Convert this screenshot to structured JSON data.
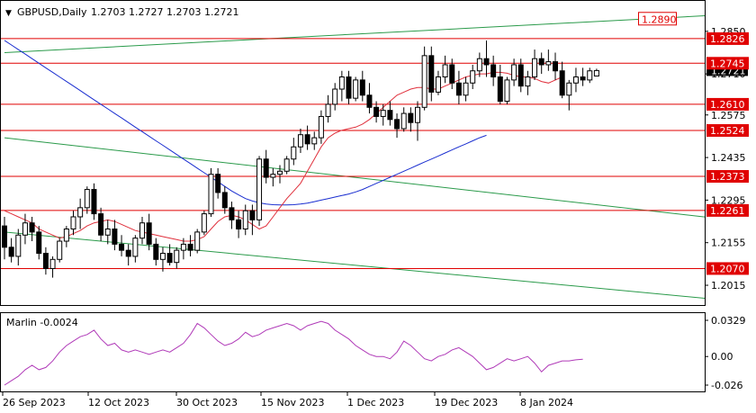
{
  "header": {
    "arrow": "▼",
    "symbol": "GBPUSD,Daily",
    "ohlc": "1.2703 1.2727 1.2703 1.2721"
  },
  "price_axis_ticks": [
    "1.2850",
    "1.2710",
    "1.2575",
    "1.2435",
    "1.2295",
    "1.2155",
    "1.2015"
  ],
  "current_price_label": "1.2721",
  "levels": [
    {
      "value": 1.289,
      "label": "1.2890",
      "boxed": true
    },
    {
      "value": 1.2826,
      "label": "1.2826",
      "boxed": false
    },
    {
      "value": 1.2745,
      "label": "1.2745",
      "boxed": false
    },
    {
      "value": 1.261,
      "label": "1.2610",
      "boxed": false
    },
    {
      "value": 1.2524,
      "label": "1.2524",
      "boxed": false
    },
    {
      "value": 1.2373,
      "label": "1.2373",
      "boxed": false
    },
    {
      "value": 1.2261,
      "label": "1.2261",
      "boxed": false
    },
    {
      "value": 1.207,
      "label": "1.2070",
      "boxed": false
    }
  ],
  "indicator": {
    "name": "Marlin -0.0024",
    "ticks": [
      "0.0329",
      "0.00",
      "-0.026"
    ]
  },
  "date_labels": [
    "26 Sep 2023",
    "12 Oct 2023",
    "30 Oct 2023",
    "15 Nov 2023",
    "1 Dec 2023",
    "19 Dec 2023",
    "8 Jan 2024"
  ],
  "colors": {
    "background": "#ffffff",
    "level_line": "#e00000",
    "red_ma": "#e0303c",
    "blue_ma": "#1a2ed0",
    "trend_line": "#2a9a4a",
    "marlin": "#b03ab8",
    "candle_bull": "#ffffff",
    "candle_bear": "#000000"
  },
  "chart_data": {
    "type": "candlestick",
    "symbol": "GBPUSD",
    "timeframe": "Daily",
    "ylim": [
      1.195,
      1.295
    ],
    "candles": [
      [
        1.221,
        1.224,
        1.21,
        1.214
      ],
      [
        1.214,
        1.217,
        1.209,
        1.211
      ],
      [
        1.211,
        1.22,
        1.208,
        1.218
      ],
      [
        1.218,
        1.225,
        1.215,
        1.222
      ],
      [
        1.222,
        1.224,
        1.216,
        1.219
      ],
      [
        1.219,
        1.221,
        1.21,
        1.212
      ],
      [
        1.212,
        1.214,
        1.205,
        1.207
      ],
      [
        1.207,
        1.211,
        1.204,
        1.21
      ],
      [
        1.21,
        1.217,
        1.209,
        1.216
      ],
      [
        1.216,
        1.221,
        1.214,
        1.22
      ],
      [
        1.22,
        1.226,
        1.218,
        1.224
      ],
      [
        1.224,
        1.23,
        1.22,
        1.227
      ],
      [
        1.227,
        1.234,
        1.225,
        1.233
      ],
      [
        1.233,
        1.235,
        1.223,
        1.225
      ],
      [
        1.225,
        1.227,
        1.216,
        1.218
      ],
      [
        1.218,
        1.223,
        1.215,
        1.22
      ],
      [
        1.22,
        1.223,
        1.213,
        1.215
      ],
      [
        1.215,
        1.218,
        1.211,
        1.213
      ],
      [
        1.213,
        1.215,
        1.208,
        1.211
      ],
      [
        1.211,
        1.218,
        1.209,
        1.217
      ],
      [
        1.217,
        1.224,
        1.215,
        1.222
      ],
      [
        1.222,
        1.225,
        1.213,
        1.215
      ],
      [
        1.215,
        1.217,
        1.208,
        1.21
      ],
      [
        1.21,
        1.214,
        1.206,
        1.212
      ],
      [
        1.212,
        1.215,
        1.208,
        1.209
      ],
      [
        1.209,
        1.214,
        1.207,
        1.213
      ],
      [
        1.213,
        1.217,
        1.21,
        1.215
      ],
      [
        1.215,
        1.218,
        1.211,
        1.213
      ],
      [
        1.213,
        1.22,
        1.212,
        1.219
      ],
      [
        1.219,
        1.226,
        1.218,
        1.225
      ],
      [
        1.225,
        1.24,
        1.224,
        1.238
      ],
      [
        1.238,
        1.24,
        1.23,
        1.232
      ],
      [
        1.232,
        1.234,
        1.225,
        1.227
      ],
      [
        1.227,
        1.229,
        1.22,
        1.223
      ],
      [
        1.223,
        1.226,
        1.217,
        1.22
      ],
      [
        1.22,
        1.228,
        1.218,
        1.226
      ],
      [
        1.226,
        1.228,
        1.218,
        1.223
      ],
      [
        1.223,
        1.244,
        1.221,
        1.243
      ],
      [
        1.243,
        1.246,
        1.235,
        1.237
      ],
      [
        1.237,
        1.24,
        1.234,
        1.238
      ],
      [
        1.238,
        1.241,
        1.235,
        1.239
      ],
      [
        1.239,
        1.244,
        1.238,
        1.243
      ],
      [
        1.243,
        1.25,
        1.241,
        1.247
      ],
      [
        1.247,
        1.253,
        1.245,
        1.251
      ],
      [
        1.251,
        1.254,
        1.246,
        1.248
      ],
      [
        1.248,
        1.252,
        1.246,
        1.25
      ],
      [
        1.25,
        1.259,
        1.248,
        1.257
      ],
      [
        1.257,
        1.264,
        1.255,
        1.261
      ],
      [
        1.261,
        1.268,
        1.259,
        1.266
      ],
      [
        1.266,
        1.272,
        1.262,
        1.27
      ],
      [
        1.27,
        1.272,
        1.261,
        1.263
      ],
      [
        1.263,
        1.27,
        1.262,
        1.269
      ],
      [
        1.269,
        1.272,
        1.262,
        1.264
      ],
      [
        1.264,
        1.268,
        1.258,
        1.26
      ],
      [
        1.26,
        1.262,
        1.255,
        1.257
      ],
      [
        1.257,
        1.261,
        1.254,
        1.259
      ],
      [
        1.259,
        1.262,
        1.254,
        1.256
      ],
      [
        1.256,
        1.258,
        1.25,
        1.253
      ],
      [
        1.253,
        1.26,
        1.252,
        1.258
      ],
      [
        1.258,
        1.26,
        1.252,
        1.255
      ],
      [
        1.255,
        1.262,
        1.249,
        1.26
      ],
      [
        1.26,
        1.28,
        1.259,
        1.277
      ],
      [
        1.277,
        1.28,
        1.262,
        1.265
      ],
      [
        1.265,
        1.272,
        1.264,
        1.27
      ],
      [
        1.27,
        1.277,
        1.268,
        1.274
      ],
      [
        1.274,
        1.276,
        1.266,
        1.268
      ],
      [
        1.268,
        1.272,
        1.261,
        1.264
      ],
      [
        1.264,
        1.27,
        1.262,
        1.268
      ],
      [
        1.268,
        1.274,
        1.266,
        1.272
      ],
      [
        1.272,
        1.278,
        1.27,
        1.276
      ],
      [
        1.276,
        1.282,
        1.27,
        1.274
      ],
      [
        1.274,
        1.277,
        1.267,
        1.27
      ],
      [
        1.27,
        1.274,
        1.261,
        1.262
      ],
      [
        1.262,
        1.27,
        1.261,
        1.269
      ],
      [
        1.269,
        1.276,
        1.267,
        1.274
      ],
      [
        1.274,
        1.276,
        1.265,
        1.267
      ],
      [
        1.267,
        1.272,
        1.264,
        1.27
      ],
      [
        1.27,
        1.279,
        1.269,
        1.276
      ],
      [
        1.276,
        1.278,
        1.271,
        1.274
      ],
      [
        1.274,
        1.279,
        1.272,
        1.275
      ],
      [
        1.275,
        1.278,
        1.269,
        1.272
      ],
      [
        1.272,
        1.275,
        1.263,
        1.264
      ],
      [
        1.264,
        1.269,
        1.259,
        1.268
      ],
      [
        1.268,
        1.273,
        1.265,
        1.27
      ],
      [
        1.27,
        1.273,
        1.267,
        1.269
      ],
      [
        1.269,
        1.273,
        1.268,
        1.272
      ],
      [
        1.2703,
        1.2727,
        1.2703,
        1.2721
      ]
    ],
    "red_ma": [
      1.226,
      1.225,
      1.224,
      1.223,
      1.222,
      1.22,
      1.219,
      1.218,
      1.217,
      1.2175,
      1.2185,
      1.2195,
      1.221,
      1.222,
      1.2225,
      1.223,
      1.2225,
      1.2215,
      1.2205,
      1.2195,
      1.219,
      1.2185,
      1.218,
      1.2175,
      1.217,
      1.2165,
      1.216,
      1.216,
      1.2165,
      1.2175,
      1.22,
      1.2225,
      1.224,
      1.2245,
      1.224,
      1.223,
      1.2215,
      1.22,
      1.221,
      1.224,
      1.227,
      1.23,
      1.2325,
      1.235,
      1.239,
      1.243,
      1.247,
      1.25,
      1.2515,
      1.2525,
      1.253,
      1.2535,
      1.2545,
      1.256,
      1.258,
      1.26,
      1.262,
      1.264,
      1.265,
      1.266,
      1.2665,
      1.2665,
      1.266,
      1.266,
      1.267,
      1.268,
      1.269,
      1.27,
      1.2705,
      1.271,
      1.271,
      1.2715,
      1.2715,
      1.2712,
      1.2705,
      1.27,
      1.27,
      1.2695,
      1.2685,
      1.268,
      1.269,
      1.27
    ],
    "blue_ma": [
      1.282,
      1.2805,
      1.279,
      1.2775,
      1.276,
      1.2745,
      1.273,
      1.2715,
      1.27,
      1.2685,
      1.267,
      1.2655,
      1.264,
      1.2625,
      1.261,
      1.2595,
      1.258,
      1.2565,
      1.255,
      1.2535,
      1.252,
      1.2505,
      1.249,
      1.2475,
      1.246,
      1.2445,
      1.243,
      1.2415,
      1.24,
      1.2385,
      1.237,
      1.2355,
      1.234,
      1.2325,
      1.2312,
      1.23,
      1.2292,
      1.2286,
      1.2282,
      1.228,
      1.2279,
      1.2279,
      1.228,
      1.2282,
      1.2285,
      1.229,
      1.2295,
      1.23,
      1.2305,
      1.231,
      1.2315,
      1.2322,
      1.233,
      1.234,
      1.235,
      1.236,
      1.237,
      1.238,
      1.239,
      1.24,
      1.241,
      1.242,
      1.243,
      1.244,
      1.245,
      1.246,
      1.247,
      1.248,
      1.249,
      1.25,
      1.2508
    ],
    "marlin": [
      -0.026,
      -0.022,
      -0.018,
      -0.012,
      -0.008,
      -0.012,
      -0.01,
      -0.004,
      0.004,
      0.01,
      0.014,
      0.018,
      0.02,
      0.024,
      0.016,
      0.01,
      0.012,
      0.006,
      0.004,
      0.006,
      0.004,
      0.002,
      0.004,
      0.006,
      0.004,
      0.008,
      0.012,
      0.02,
      0.03,
      0.026,
      0.02,
      0.014,
      0.01,
      0.012,
      0.016,
      0.022,
      0.018,
      0.02,
      0.024,
      0.026,
      0.028,
      0.03,
      0.028,
      0.024,
      0.028,
      0.03,
      0.032,
      0.03,
      0.024,
      0.02,
      0.016,
      0.01,
      0.006,
      0.002,
      0.0,
      0.0,
      -0.002,
      0.004,
      0.014,
      0.01,
      0.004,
      -0.002,
      -0.004,
      0.0,
      0.002,
      0.006,
      0.008,
      0.004,
      0.0,
      -0.006,
      -0.012,
      -0.01,
      -0.006,
      -0.002,
      -0.004,
      -0.002,
      0.0,
      -0.006,
      -0.014,
      -0.008,
      -0.006,
      -0.004,
      -0.004,
      -0.003,
      -0.0024
    ],
    "trend_lines": [
      {
        "from": [
          0,
          1.278
        ],
        "to": [
          84,
          1.288
        ],
        "note": "upper green channel"
      },
      {
        "from": [
          0,
          1.25
        ],
        "to": [
          84,
          1.2285
        ]
      },
      {
        "from": [
          0,
          1.219
        ],
        "to": [
          84,
          1.201
        ]
      }
    ]
  }
}
